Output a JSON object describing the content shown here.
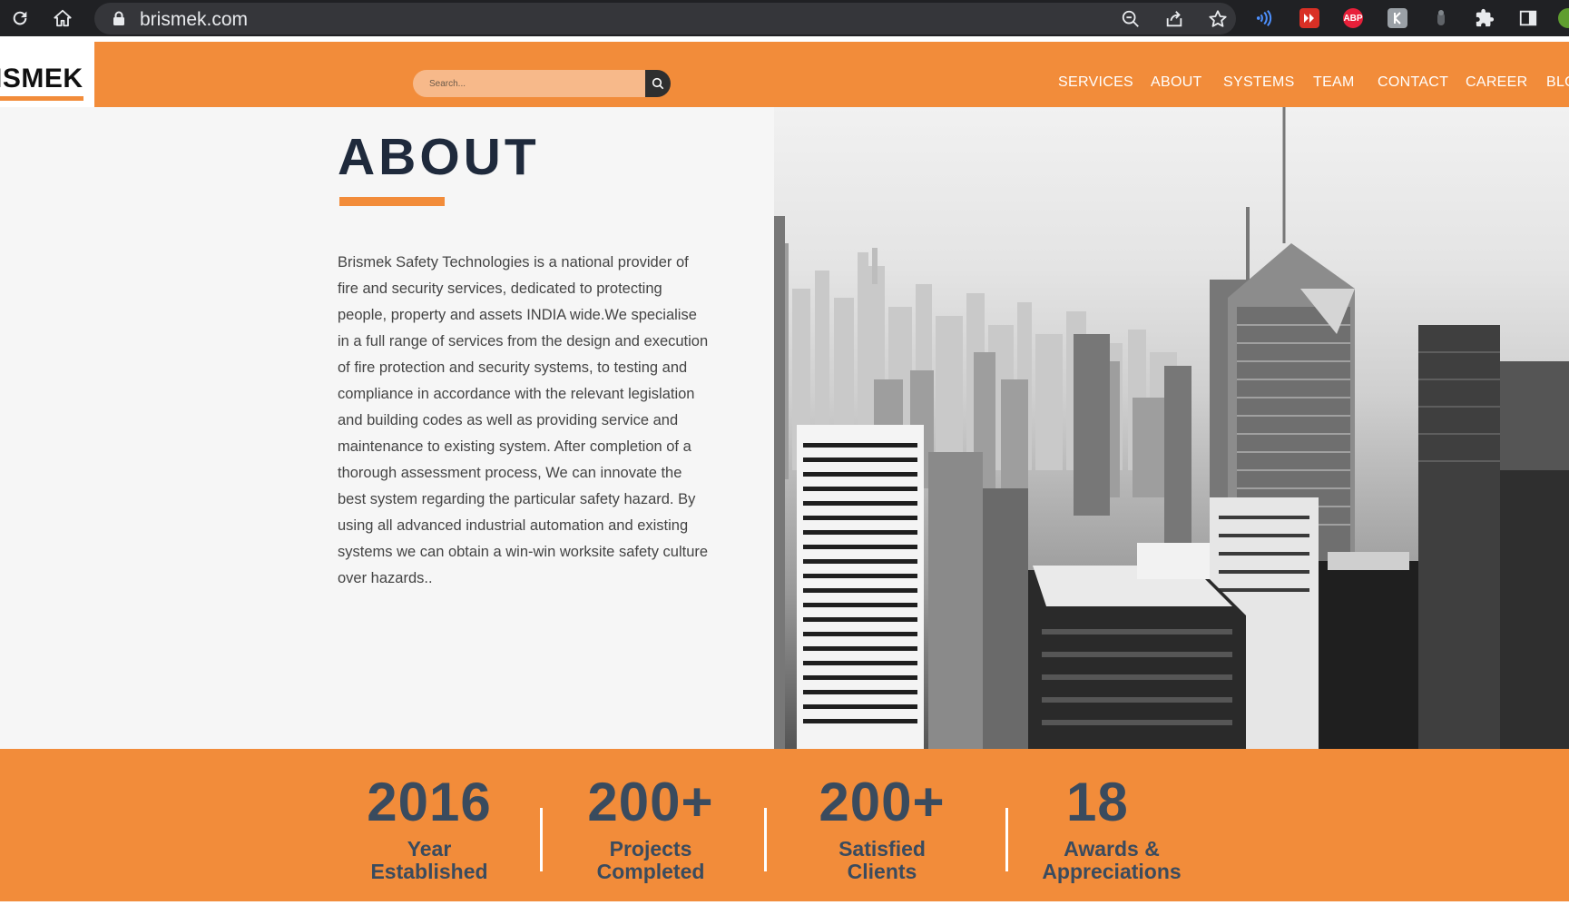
{
  "browser": {
    "url": "brismek.com",
    "extensions": [
      "ABP"
    ]
  },
  "header": {
    "logo_text": "ISMEK",
    "search": {
      "placeholder": "Search..."
    },
    "nav": [
      "SERVICES",
      "ABOUT",
      "SYSTEMS",
      "TEAM",
      "CONTACT",
      "CAREER",
      "BLO"
    ]
  },
  "about": {
    "title": "ABOUT",
    "body": "Brismek Safety Technologies is a national provider of fire and security services, dedicated to protecting people, property and assets INDIA wide.We specialise in a full range of services from the design and execution of fire protection and security systems, to testing and compliance in accordance with the relevant legislation and building codes as well as providing service and maintenance to existing system. After completion of a thorough assessment process, We can innovate the best system regarding the particular safety hazard. By using all advanced industrial automation and existing systems we can obtain a win-win worksite safety culture over hazards.."
  },
  "stats": [
    {
      "number": "2016",
      "label_line1": "Year",
      "label_line2": "Established"
    },
    {
      "number": "200+",
      "label_line1": "Projects",
      "label_line2": "Completed"
    },
    {
      "number": "200+",
      "label_line1": "Satisfied",
      "label_line2": "Clients"
    },
    {
      "number": "18",
      "label_line1": "Awards &",
      "label_line2": "Appreciations"
    }
  ],
  "colors": {
    "brand_orange": "#f28c3a",
    "stat_text": "#3a4b5e",
    "title_text": "#1f2a3c"
  }
}
